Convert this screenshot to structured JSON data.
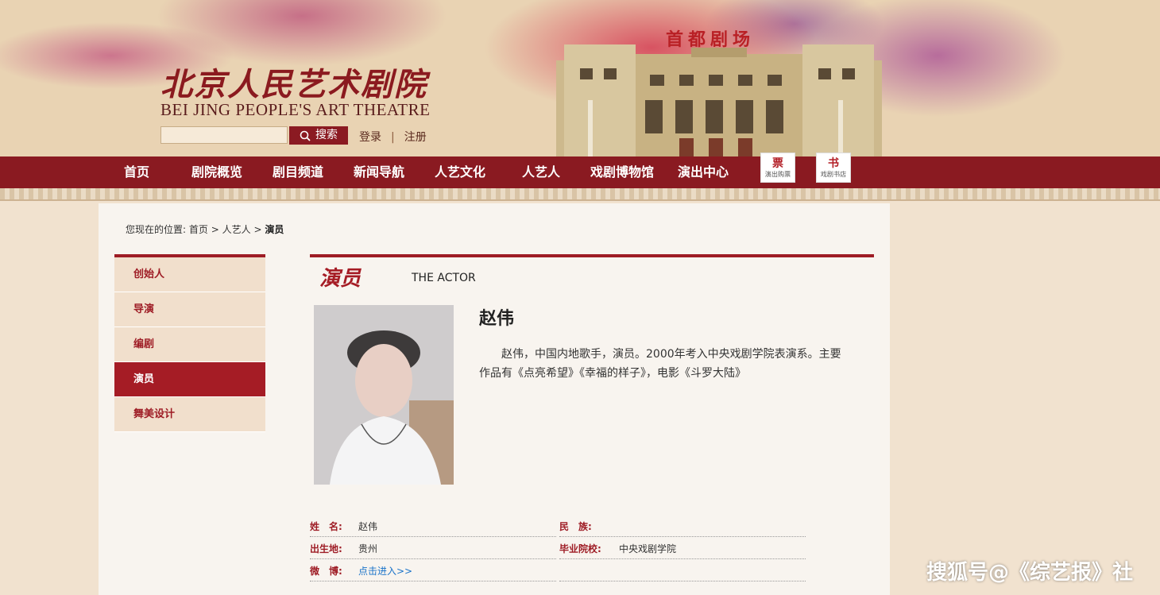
{
  "header": {
    "logo_cn": "北京人民艺术剧院",
    "logo_en": "BEI JING PEOPLE'S ART THEATRE",
    "search_placeholder": "",
    "search_button": "搜索",
    "login": "登录",
    "separator": "|",
    "register": "注册",
    "capital_theatre": "首都剧场"
  },
  "nav": {
    "items": [
      "首页",
      "剧院概览",
      "剧目频道",
      "新闻导航",
      "人艺文化",
      "人艺人",
      "戏剧博物馆",
      "演出中心"
    ],
    "ticket_tile": {
      "big": "票",
      "small": "演出购票"
    },
    "book_tile": {
      "big": "书",
      "small": "戏剧书店"
    }
  },
  "breadcrumb": {
    "prefix": "您现在的位置:",
    "home": "首页",
    "parent": "人艺人",
    "current": "演员",
    "sep": ">"
  },
  "sidebar": {
    "items": [
      "创始人",
      "导演",
      "编剧",
      "演员",
      "舞美设计"
    ],
    "active_index": 3
  },
  "section": {
    "title_cn": "演员",
    "title_en": "THE ACTOR"
  },
  "actor": {
    "name": "赵伟",
    "bio": "赵伟，中国内地歌手，演员。2000年考入中央戏剧学院表演系。主要作品有《点亮希望》《幸福的样子》，电影《斗罗大陆》"
  },
  "info": {
    "name_label": "姓　名:",
    "name_value": "赵伟",
    "ethnicity_label": "民　族:",
    "ethnicity_value": "",
    "birthplace_label": "出生地:",
    "birthplace_value": "贵州",
    "school_label": "毕业院校:",
    "school_value": "中央戏剧学院",
    "weibo_label": "微　博:",
    "weibo_value": "点击进入>>"
  },
  "watermark": "搜狐号@《综艺报》社",
  "colors": {
    "brand_red": "#8a1a21",
    "accent_red": "#a51c25",
    "link_blue": "#1a73c9"
  }
}
